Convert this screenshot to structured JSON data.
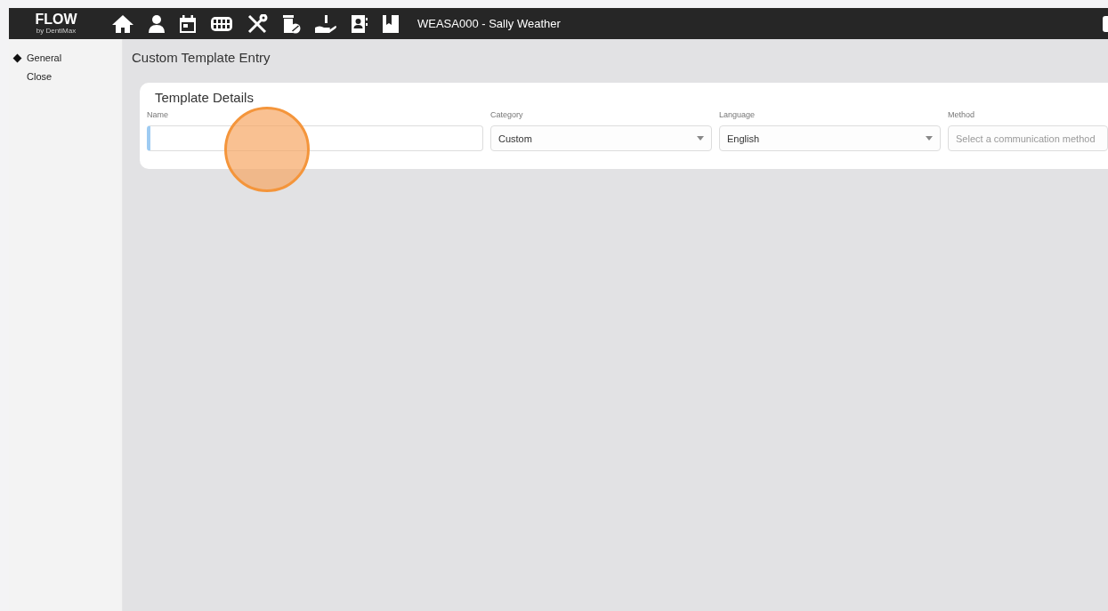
{
  "logo": {
    "name": "FLOW",
    "tagline": "by DentiMax"
  },
  "header": {
    "patient": "WEASA000 - Sally Weather"
  },
  "sidebar": {
    "items": [
      {
        "label": "General",
        "selected": true
      },
      {
        "label": "Close",
        "selected": false
      }
    ]
  },
  "page_title": "Custom Template Entry",
  "card": {
    "title": "Template Details",
    "fields": [
      {
        "label": "Name",
        "kind": "text",
        "focused": true
      },
      {
        "label": "Category",
        "kind": "select",
        "value": "Custom"
      },
      {
        "label": "Language",
        "kind": "select",
        "value": "English"
      },
      {
        "label": "Method",
        "kind": "select",
        "placeholder": "Select a communication method"
      }
    ]
  }
}
